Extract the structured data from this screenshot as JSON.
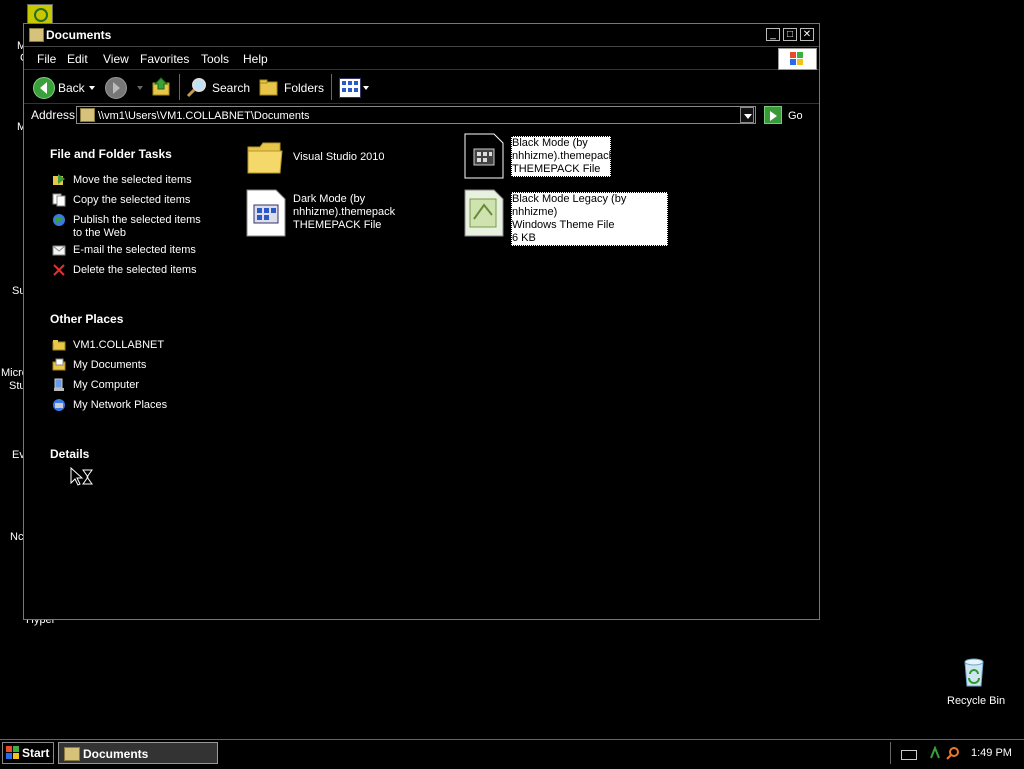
{
  "desktop": {
    "left_fragments": [
      "M",
      "C",
      "M",
      "Su",
      "Micro",
      "Stu",
      "Ev",
      "Nc",
      "Hyper"
    ],
    "recycle_bin_label": "Recycle Bin"
  },
  "window": {
    "title": "Documents",
    "controls": {
      "minimize": "_",
      "maximize": "□",
      "close": "✕"
    }
  },
  "menu": {
    "items": [
      {
        "label": "File"
      },
      {
        "label": "Edit"
      },
      {
        "label": "View"
      },
      {
        "label": "Favorites"
      },
      {
        "label": "Tools"
      },
      {
        "label": "Help"
      }
    ]
  },
  "toolbar": {
    "back_label": "Back",
    "search_label": "Search",
    "folders_label": "Folders"
  },
  "address": {
    "label": "Address",
    "value": "\\\\vm1\\Users\\VM1.COLLABNET\\Documents",
    "go_label": "Go"
  },
  "sidebar": {
    "tasks_title": "File and Folder Tasks",
    "tasks": [
      {
        "label": "Move the selected items"
      },
      {
        "label": "Copy the selected items"
      },
      {
        "label": "Publish the selected items",
        "label2": "to the Web"
      },
      {
        "label": "E-mail the selected items"
      },
      {
        "label": "Delete the selected items"
      }
    ],
    "places_title": "Other Places",
    "places": [
      {
        "label": "VM1.COLLABNET"
      },
      {
        "label": "My Documents"
      },
      {
        "label": "My Computer"
      },
      {
        "label": "My Network Places"
      }
    ],
    "details_title": "Details"
  },
  "files": [
    {
      "lines": [
        "Visual Studio 2010"
      ],
      "icon": "folder-icon",
      "selected": false
    },
    {
      "lines": [
        "Black Mode (by",
        "nhhizme).themepack",
        "THEMEPACK File"
      ],
      "icon": "themepack-icon",
      "selected": true
    },
    {
      "lines": [
        "Dark Mode (by",
        "nhhizme).themepack",
        "THEMEPACK File"
      ],
      "icon": "themepack-icon",
      "selected": false
    },
    {
      "lines": [
        "Black Mode Legacy (by nhhizme)",
        "Windows Theme File",
        "6 KB"
      ],
      "icon": "theme-file-icon",
      "selected": true
    }
  ],
  "taskbar": {
    "start_label": "Start",
    "task_label": "Documents",
    "clock": "1:49 PM"
  },
  "colors": {
    "background": "#000000",
    "folder_yellow": "#e8c64a",
    "go_green": "#3a9a3a",
    "selection": "#ffffff"
  }
}
